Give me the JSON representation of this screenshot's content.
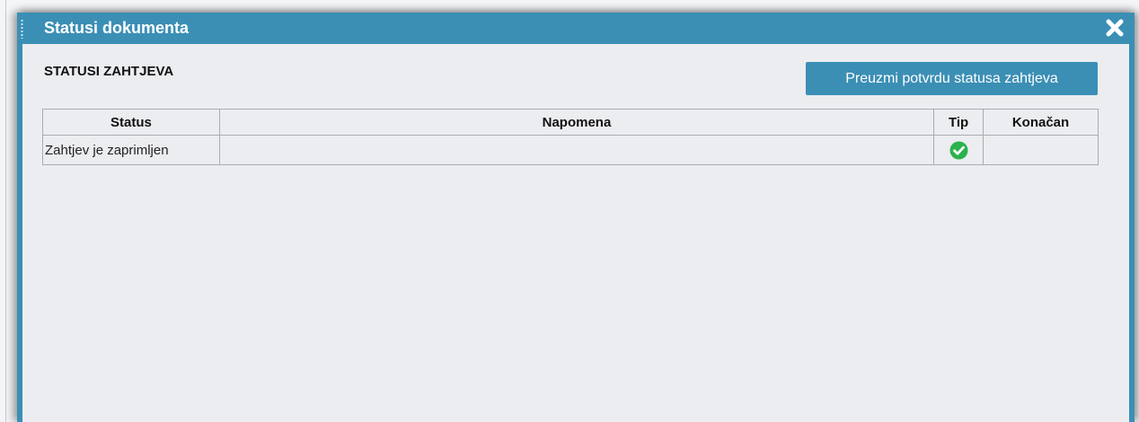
{
  "dialog": {
    "title": "Statusi dokumenta",
    "close_icon": "close-icon"
  },
  "section": {
    "title": "STATUSI ZAHTJEVA"
  },
  "download_button": {
    "label": "Preuzmi potvrdu statusa zahtjeva"
  },
  "table": {
    "columns": [
      "Status",
      "Napomena",
      "Tip",
      "Konačan"
    ],
    "rows": [
      {
        "status": "Zahtjev je zaprimljen",
        "napomena": "",
        "tip_icon": "check-circle-icon",
        "konacan": ""
      }
    ]
  },
  "colors": {
    "accent": "#3b8fb5",
    "body_bg": "#ecedf0",
    "success": "#2bb24c"
  }
}
